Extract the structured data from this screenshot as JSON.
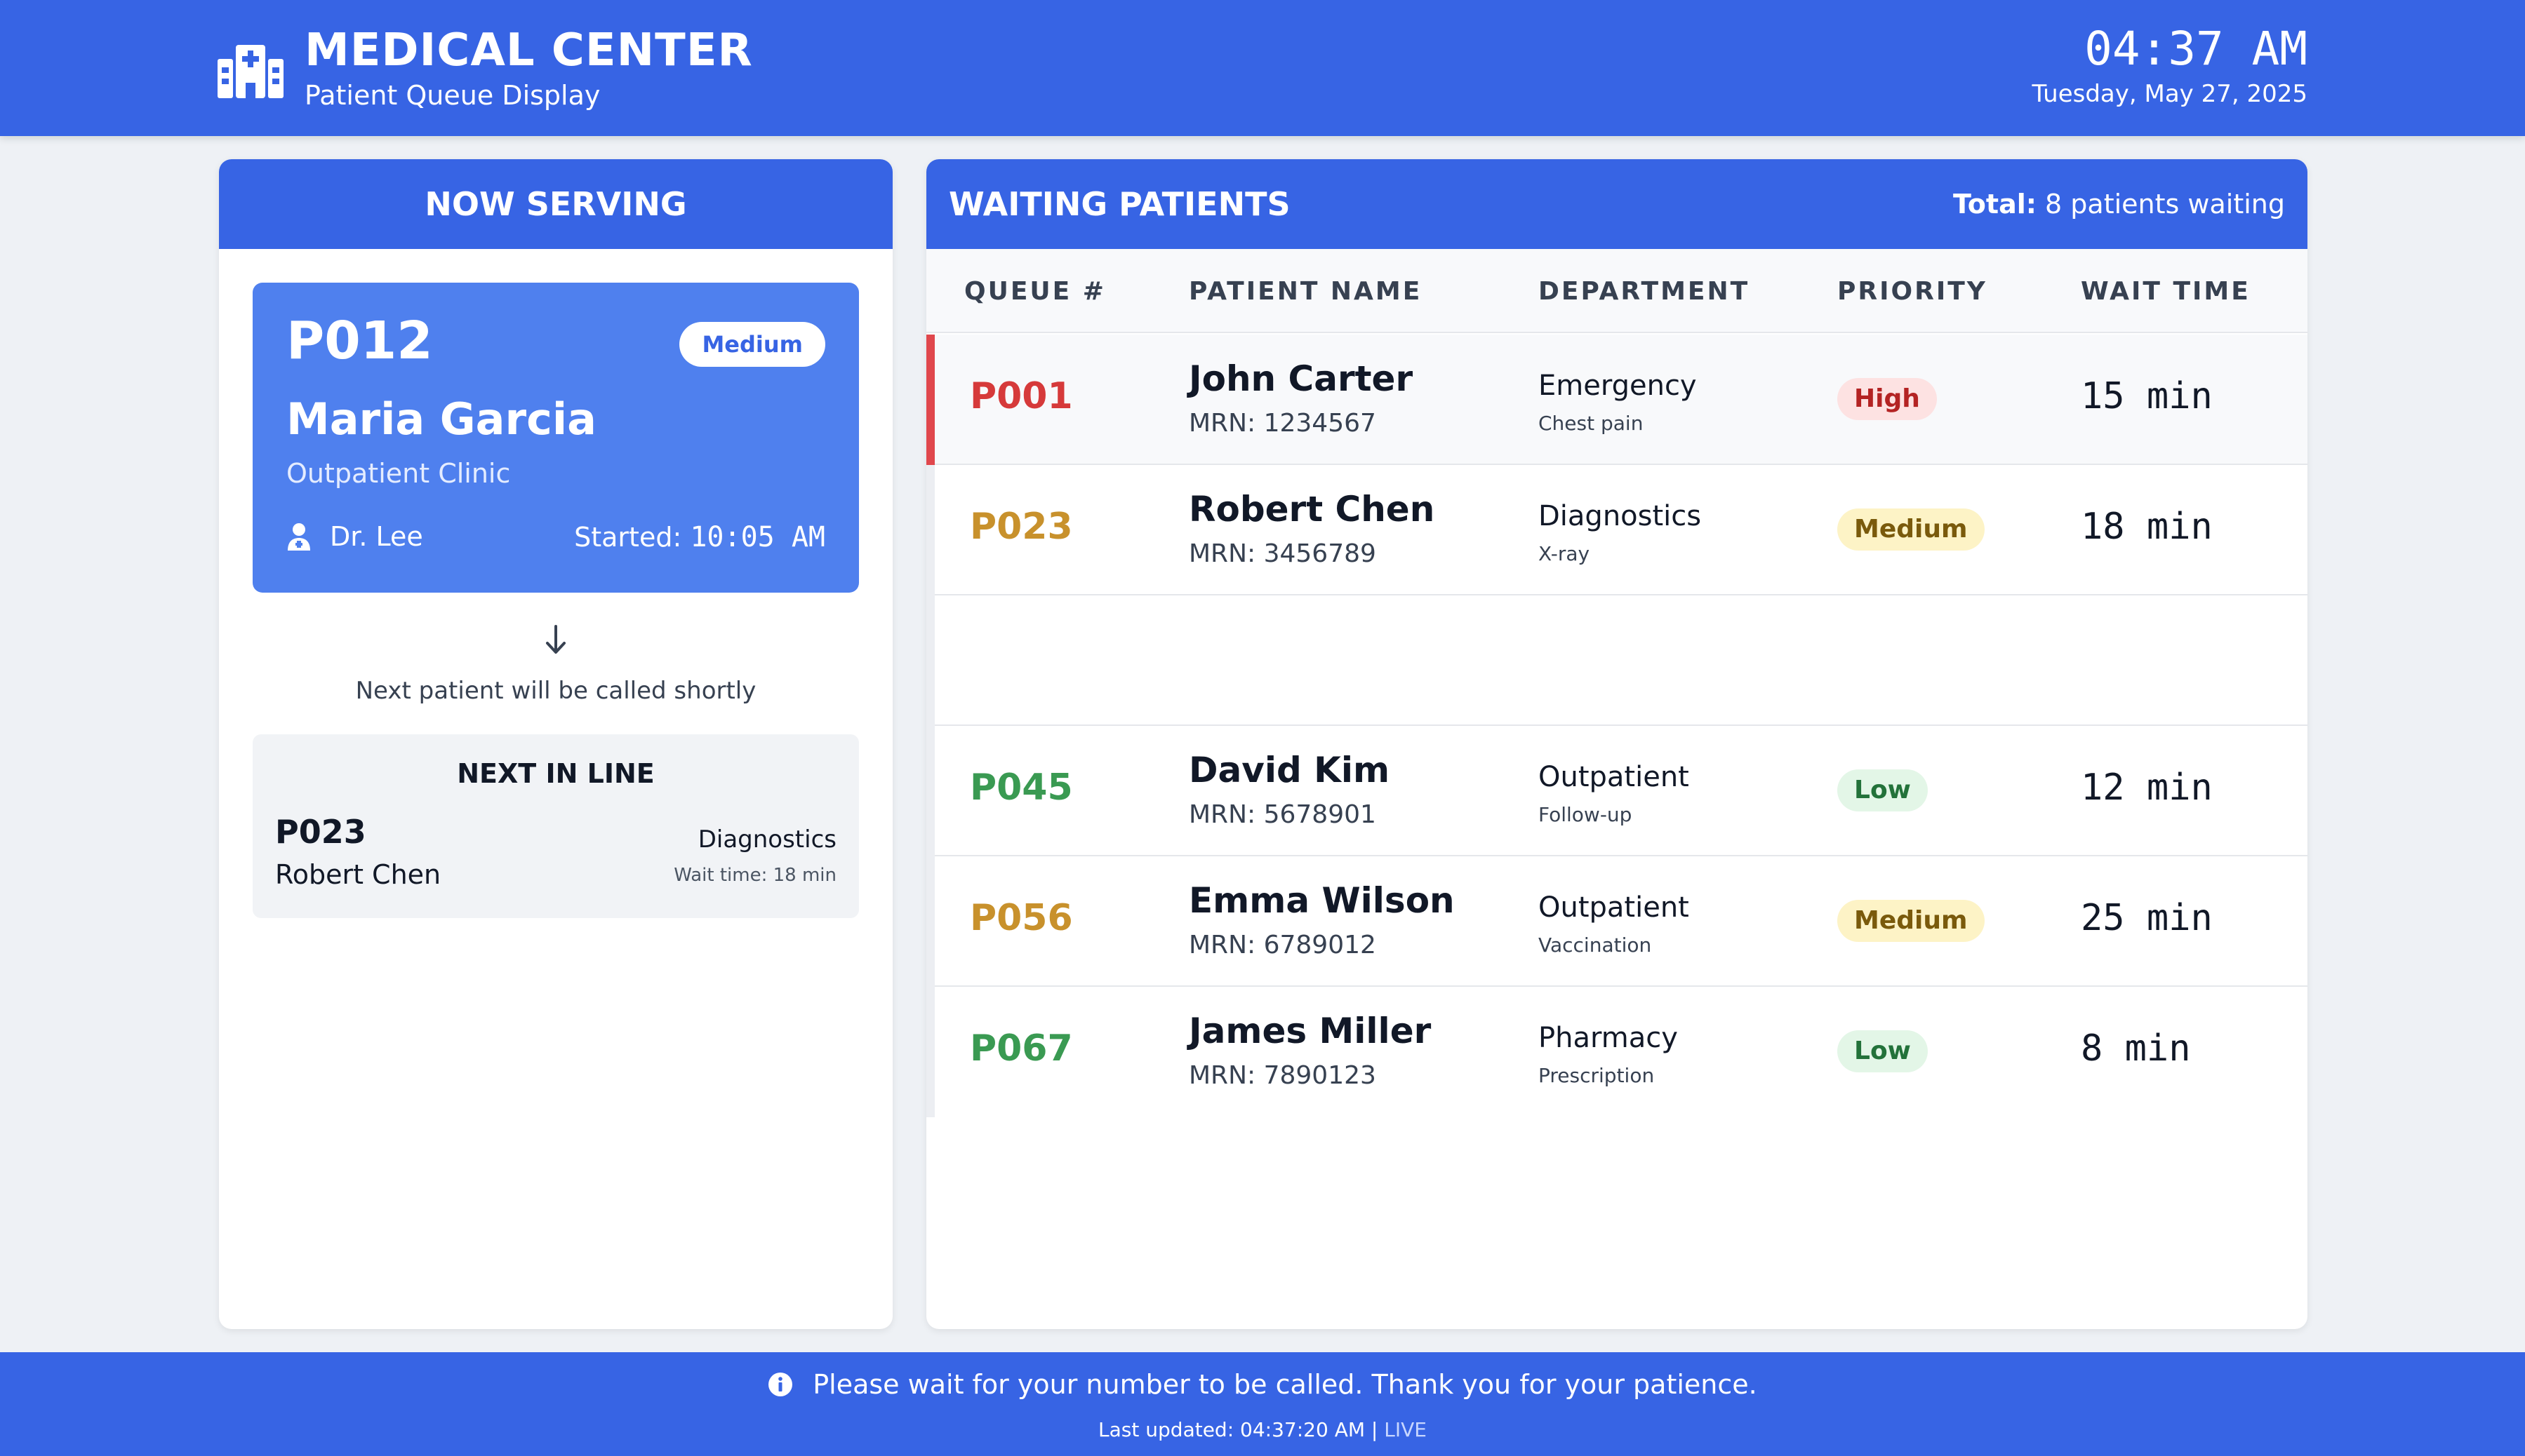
{
  "header": {
    "title": "MEDICAL CENTER",
    "subtitle": "Patient Queue Display",
    "time": "04:37 AM",
    "date": "Tuesday, May 27, 2025"
  },
  "now_serving": {
    "heading": "NOW SERVING",
    "queue_number": "P012",
    "priority": "Medium",
    "patient_name": "Maria Garcia",
    "department": "Outpatient Clinic",
    "doctor": "Dr. Lee",
    "started_label": "Started:",
    "started_time": "10:05 AM",
    "next_message": "Next patient will be called shortly"
  },
  "next_in_line": {
    "heading": "NEXT IN LINE",
    "queue_number": "P023",
    "patient_name": "Robert Chen",
    "department": "Diagnostics",
    "wait": "Wait time: 18 min"
  },
  "waiting": {
    "heading": "WAITING PATIENTS",
    "total_label": "Total:",
    "total_text": "8 patients waiting",
    "columns": [
      "QUEUE #",
      "PATIENT NAME",
      "DEPARTMENT",
      "PRIORITY",
      "WAIT TIME"
    ],
    "rows": [
      {
        "queue": "P001",
        "name": "John Carter",
        "mrn": "MRN: 1234567",
        "department": "Emergency",
        "sub": "Chest pain",
        "priority": "High",
        "wait": "15 min"
      },
      {
        "queue": "P023",
        "name": "Robert Chen",
        "mrn": "MRN: 3456789",
        "department": "Diagnostics",
        "sub": "X-ray",
        "priority": "Medium",
        "wait": "18 min"
      },
      {
        "queue": "P045",
        "name": "David Kim",
        "mrn": "MRN: 5678901",
        "department": "Outpatient",
        "sub": "Follow-up",
        "priority": "Low",
        "wait": "12 min"
      },
      {
        "queue": "P056",
        "name": "Emma Wilson",
        "mrn": "MRN: 6789012",
        "department": "Outpatient",
        "sub": "Vaccination",
        "priority": "Medium",
        "wait": "25 min"
      },
      {
        "queue": "P067",
        "name": "James Miller",
        "mrn": "MRN: 7890123",
        "department": "Pharmacy",
        "sub": "Prescription",
        "priority": "Low",
        "wait": "8 min"
      }
    ]
  },
  "footer": {
    "message": "Please wait for your number to be called. Thank you for your patience.",
    "updated": "Last updated: 04:37:20 AM |",
    "live": "LIVE"
  },
  "colors": {
    "brand": "#3764e4",
    "high": "#d63a3a",
    "medium": "#c8912c",
    "low": "#3a9a52"
  }
}
